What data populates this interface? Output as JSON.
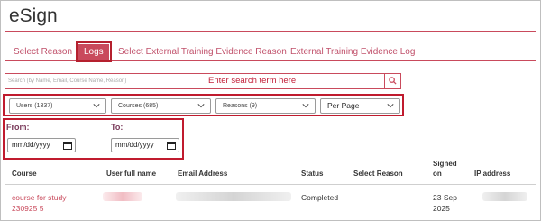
{
  "app": {
    "title": "eSign"
  },
  "tabs": [
    {
      "label": "Select Reason"
    },
    {
      "label": "Logs"
    },
    {
      "label": "Select External Training Evidence Reason"
    },
    {
      "label": "External Training Evidence Log"
    }
  ],
  "search": {
    "placeholder": "Search (by Name, Email, Course Name, Reason)",
    "annotation": "Enter search term here",
    "icon": "search-icon"
  },
  "filters": {
    "users": "Users (1337)",
    "courses": "Courses (685)",
    "reasons": "Reasons (9)",
    "per_page": "Per Page"
  },
  "dates": {
    "from_label": "From:",
    "from_value": "mm/dd/yyyy",
    "to_label": "To:",
    "to_value": "mm/dd/yyyy"
  },
  "table": {
    "headers": {
      "course": "Course",
      "user": "User full name",
      "email": "Email Address",
      "status": "Status",
      "reason": "Select Reason",
      "signed_1": "Signed",
      "signed_2": "on",
      "ip": "IP address"
    },
    "rows": [
      {
        "course_1": "course for study",
        "course_2": "230925 5",
        "status": "Completed",
        "signed_1": "23 Sep",
        "signed_2": "2025"
      }
    ]
  },
  "colors": {
    "accent": "#c94a5c",
    "highlight": "#c01b2e"
  }
}
